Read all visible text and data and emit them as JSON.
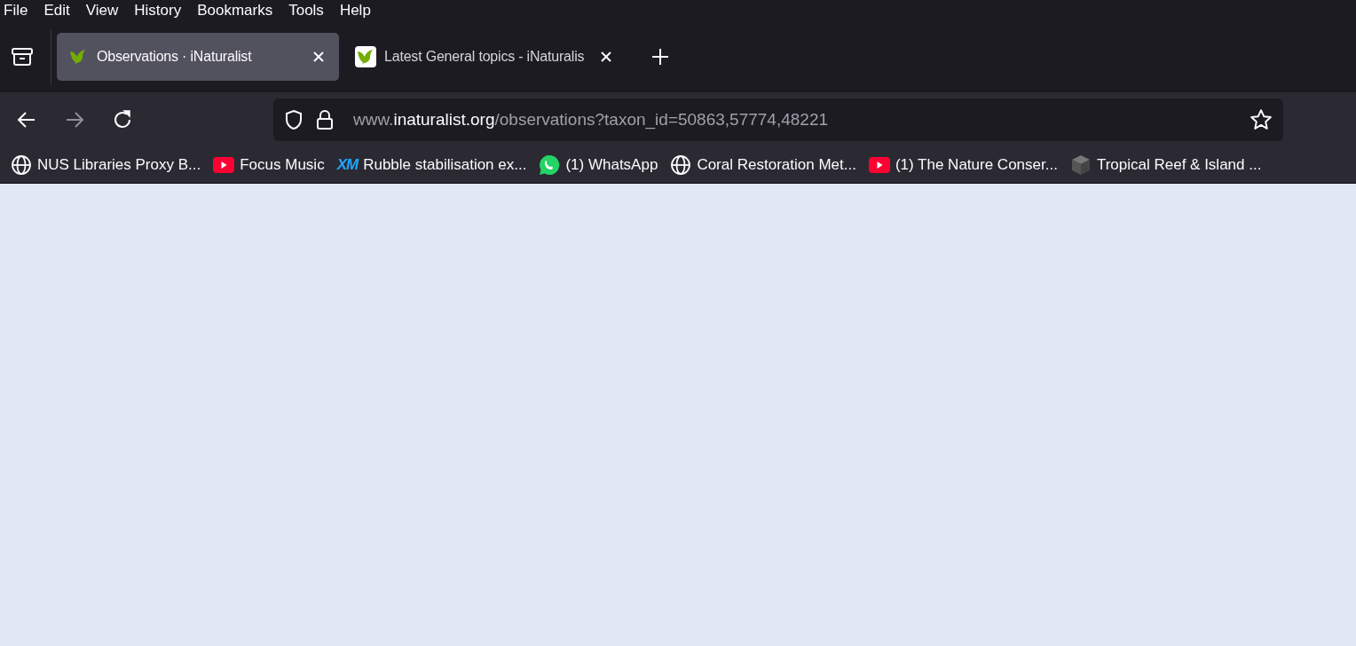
{
  "menu": [
    "File",
    "Edit",
    "View",
    "History",
    "Bookmarks",
    "Tools",
    "Help"
  ],
  "tabs": [
    {
      "title": "Observations · iNaturalist",
      "selected": true,
      "faded": false
    },
    {
      "title": "Latest General topics - iNaturalis",
      "selected": false,
      "faded": true
    }
  ],
  "nav": {
    "back_disabled": false,
    "forward_disabled": true
  },
  "url": {
    "prefix": "www.",
    "host": "inaturalist.org",
    "path": "/observations?taxon_id=50863,57774,48221"
  },
  "bookmarks": [
    {
      "kind": "globe",
      "label": "NUS Libraries Proxy B..."
    },
    {
      "kind": "youtube",
      "label": "Focus Music"
    },
    {
      "kind": "text",
      "icon_text": "XM",
      "label": "Rubble stabilisation ex..."
    },
    {
      "kind": "whatsapp",
      "label": "(1) WhatsApp"
    },
    {
      "kind": "globe",
      "label": "Coral Restoration Met..."
    },
    {
      "kind": "youtube",
      "label": "(1) The Nature Conser..."
    },
    {
      "kind": "cube",
      "label": "Tropical Reef & Island ..."
    }
  ]
}
